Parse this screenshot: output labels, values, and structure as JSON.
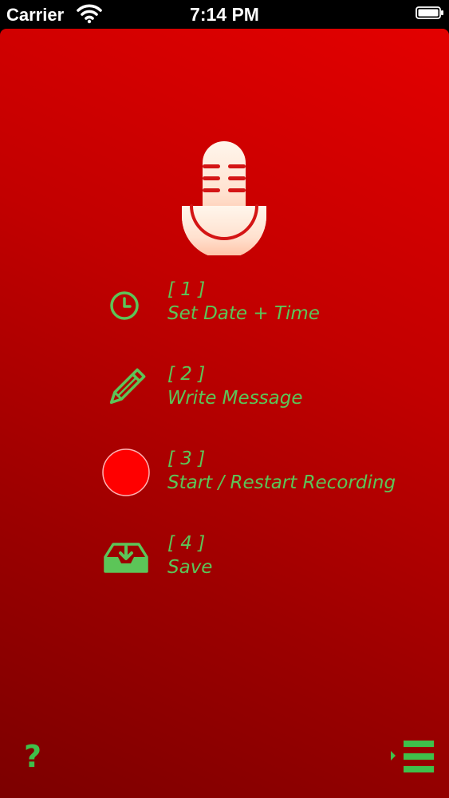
{
  "status_bar": {
    "carrier": "Carrier",
    "time": "7:14 PM"
  },
  "app": {
    "background_top": "#e30000",
    "background_bottom": "#7c0000",
    "accent": "#5cc558",
    "logo_icon": "microphone-icon",
    "steps": [
      {
        "number": "[ 1 ]",
        "label": "Set Date + Time",
        "icon": "clock-icon"
      },
      {
        "number": "[ 2 ]",
        "label": "Write Message",
        "icon": "pencil-icon"
      },
      {
        "number": "[ 3 ]",
        "label": "Start / Restart Recording",
        "icon": "record-icon"
      },
      {
        "number": "[ 4 ]",
        "label": "Save",
        "icon": "inbox-download-icon"
      }
    ],
    "help_label": "?",
    "menu_icon": "menu-icon"
  }
}
